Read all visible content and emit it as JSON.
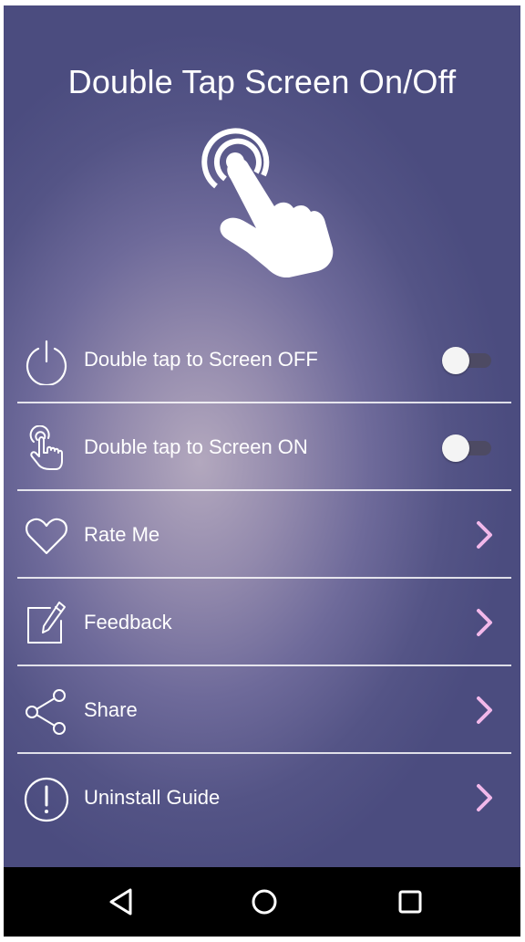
{
  "app": {
    "title": "Double Tap Screen On/Off"
  },
  "hero": {
    "icon": "double-tap-hand-icon"
  },
  "menu": {
    "items": [
      {
        "id": "screen-off",
        "icon": "power-icon",
        "label": "Double tap to Screen OFF",
        "control": "toggle",
        "checked": false
      },
      {
        "id": "screen-on",
        "icon": "tap-hand-icon",
        "label": "Double tap to Screen ON",
        "control": "toggle",
        "checked": false
      },
      {
        "id": "rate-me",
        "icon": "heart-icon",
        "label": "Rate Me",
        "control": "chevron"
      },
      {
        "id": "feedback",
        "icon": "edit-icon",
        "label": "Feedback",
        "control": "chevron"
      },
      {
        "id": "share",
        "icon": "share-icon",
        "label": "Share",
        "control": "chevron"
      },
      {
        "id": "uninstall-guide",
        "icon": "info-exclamation-icon",
        "label": "Uninstall Guide",
        "control": "chevron"
      }
    ]
  },
  "navbar": {
    "buttons": [
      "back-icon",
      "home-icon",
      "recents-icon"
    ]
  },
  "colors": {
    "chevron": "#f2b8ea",
    "toggle_track": "#4d4a63",
    "toggle_thumb": "#f4f4f4",
    "navbar": "#000000"
  }
}
